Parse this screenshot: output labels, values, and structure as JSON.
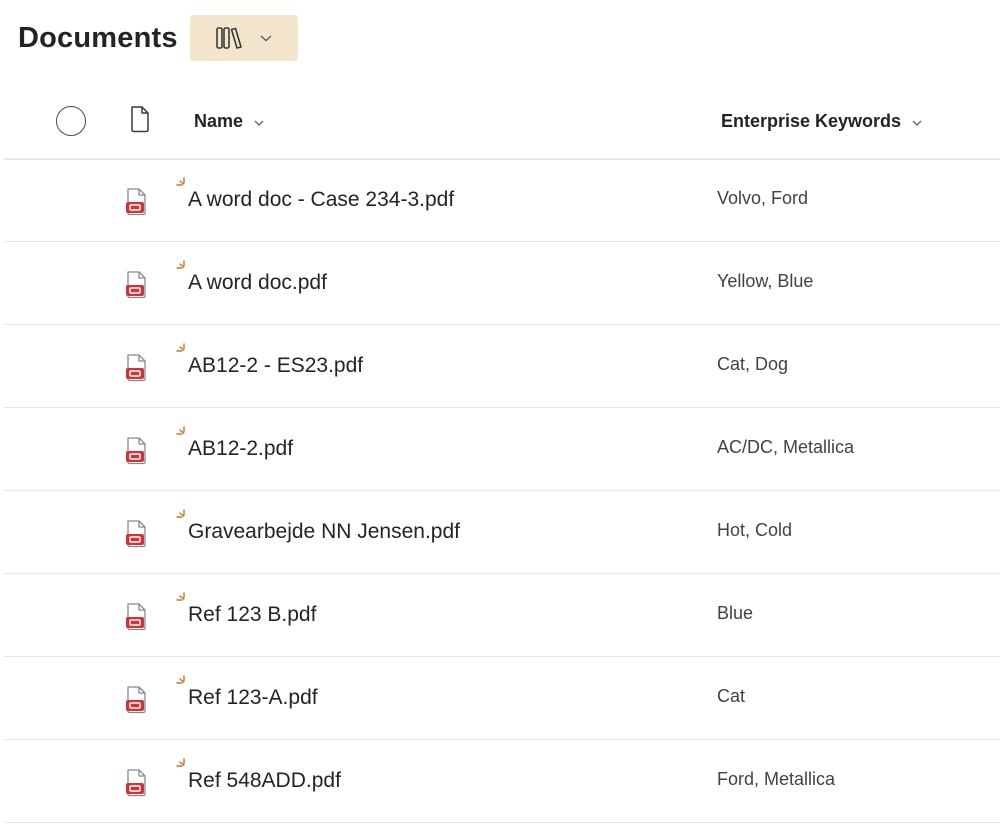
{
  "header": {
    "title": "Documents"
  },
  "view_switcher": {
    "icon": "library-icon",
    "dropdown_icon": "chevron-down-icon"
  },
  "columns": {
    "name": {
      "label": "Name"
    },
    "keywords": {
      "label": "Enterprise Keywords"
    }
  },
  "rows": [
    {
      "name": "A word doc - Case 234-3.pdf",
      "keywords": "Volvo, Ford",
      "icon": "pdf-icon",
      "new_icon": "new-item-icon"
    },
    {
      "name": "A word doc.pdf",
      "keywords": "Yellow, Blue",
      "icon": "pdf-icon",
      "new_icon": "new-item-icon"
    },
    {
      "name": "AB12-2 - ES23.pdf",
      "keywords": "Cat, Dog",
      "icon": "pdf-icon",
      "new_icon": "new-item-icon"
    },
    {
      "name": "AB12-2.pdf",
      "keywords": "AC/DC, Metallica",
      "icon": "pdf-icon",
      "new_icon": "new-item-icon"
    },
    {
      "name": "Gravearbejde NN Jensen.pdf",
      "keywords": "Hot, Cold",
      "icon": "pdf-icon",
      "new_icon": "new-item-icon"
    },
    {
      "name": "Ref 123 B.pdf",
      "keywords": "Blue",
      "icon": "pdf-icon",
      "new_icon": "new-item-icon"
    },
    {
      "name": "Ref 123-A.pdf",
      "keywords": "Cat",
      "icon": "pdf-icon",
      "new_icon": "new-item-icon"
    },
    {
      "name": "Ref 548ADD.pdf",
      "keywords": "Ford, Metallica",
      "icon": "pdf-icon",
      "new_icon": "new-item-icon"
    }
  ],
  "colors": {
    "accent_bg": "#f3e6cc",
    "pdf_red": "#d13438",
    "new_orange": "#c8742a"
  }
}
